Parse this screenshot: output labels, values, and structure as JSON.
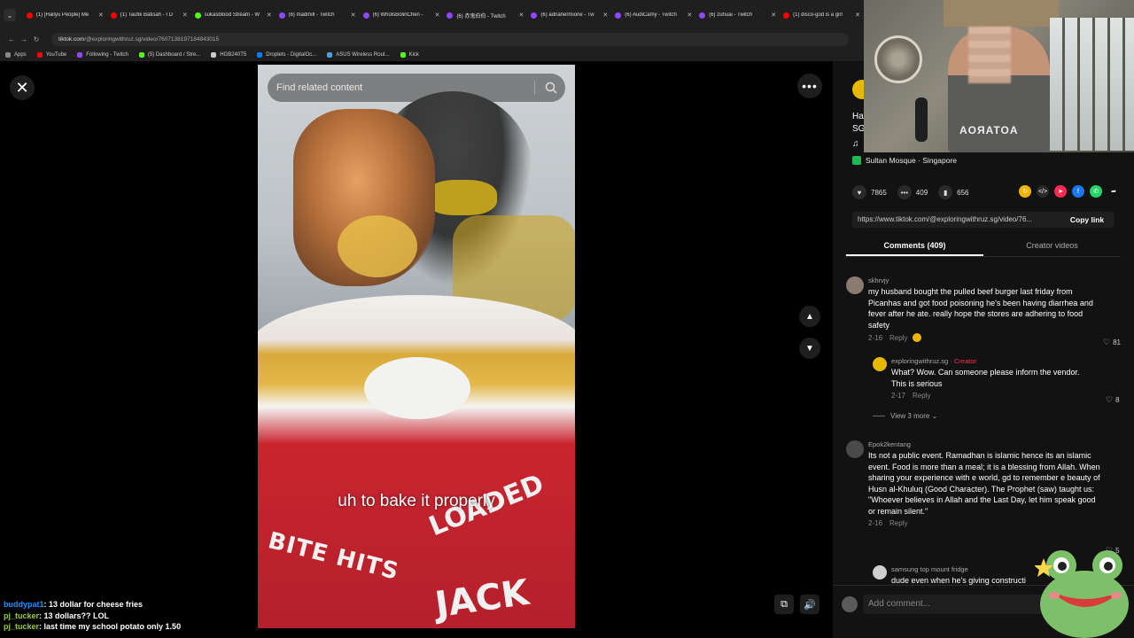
{
  "browser": {
    "tabs": [
      {
        "title": "(1) [Hallyu People] Me",
        "color": "#ff0000"
      },
      {
        "title": "(1) Taufik Batisah - I D",
        "color": "#ff0000"
      },
      {
        "title": "sukasblood Stream - W",
        "color": "#53fc18"
      },
      {
        "title": "(6) madmill - Twitch",
        "color": "#9146ff"
      },
      {
        "title": "(6) WholsBolinChen -",
        "color": "#9146ff"
      },
      {
        "title": "(6) 赤鬼伯伯 - Twitch",
        "color": "#9146ff"
      },
      {
        "title": "(6) adriahermione - Tw",
        "color": "#9146ff"
      },
      {
        "title": "(6) AudiCamy - Twitch",
        "color": "#9146ff"
      },
      {
        "title": "(6) zuhuai - Twitch",
        "color": "#9146ff"
      },
      {
        "title": "(1) disco-god is a girl",
        "color": "#ff0000"
      }
    ],
    "url_domain": "tiktok.com",
    "url_path": "/@exploringwithruz.sg/video/7607138197184843015",
    "bookmarks": [
      {
        "label": "Apps",
        "color": "#888888"
      },
      {
        "label": "YouTube",
        "color": "#ff0000"
      },
      {
        "label": "Following - Twitch",
        "color": "#9146ff"
      },
      {
        "label": "(5) Dashboard / Stre...",
        "color": "#53fc18"
      },
      {
        "label": "HGB240T5",
        "color": "#cccccc"
      },
      {
        "label": "Droplets - DigitalOc...",
        "color": "#0080ff"
      },
      {
        "label": "ASUS Wireless Rout...",
        "color": "#4aa3df"
      },
      {
        "label": "Kick",
        "color": "#53fc18"
      }
    ]
  },
  "video": {
    "search_placeholder": "Find related content",
    "caption": "uh to bake it properly",
    "cup_text_1": "BITE HITS",
    "cup_text_2": "LOADED",
    "cup_text_3": "JACK"
  },
  "webcam": {
    "shirt_text": "AOЯATOA"
  },
  "post": {
    "title_line1": "Ha",
    "title_line2": "SG",
    "music_icon": "♫",
    "location": "Sultan Mosque · Singapore",
    "likes": "7865",
    "comments": "409",
    "saves": "656",
    "link": "https://www.tiktok.com/@exploringwithruz.sg/video/76...",
    "copy_link": "Copy link",
    "tab_comments": "Comments (409)",
    "tab_creator": "Creator videos"
  },
  "comments": [
    {
      "user": "skhrvjy",
      "text": "my husband bought the pulled beef burger last friday from Picanhas and got food poisoning he's been having diarrhea and fever after he ate. really hope the stores are adhering to food safety",
      "date": "2-16",
      "reply": "Reply",
      "likes": "81"
    },
    {
      "user": "exploringwithruz.sg",
      "creator": "· Creator",
      "text": "What? Wow. Can someone please inform the vendor. This is serious",
      "date": "2-17",
      "reply": "Reply",
      "likes": "8"
    },
    {
      "user": "Epok2kentang",
      "text": "Its not a public event. Ramadhan is islamic hence its an islamic event. Food is more than a meal; it is a blessing from Allah. When sharing your experience with e world, gd to remember e beauty of Husn al-Khuluq (Good Character). The Prophet (saw) taught us: \"Whoever believes in Allah and the Last Day, let him speak good or remain silent.\"",
      "date": "2-16",
      "reply": "Reply",
      "likes": "5"
    },
    {
      "user": "samsung top mount fridge",
      "text": "dude even when he's giving constructi"
    }
  ],
  "view_more": "View 3 more",
  "add_comment_placeholder": "Add comment...",
  "chat": [
    {
      "user": "buddypat1",
      "msg": " 13 dollar for cheese fries",
      "color": "#1e90ff"
    },
    {
      "user": "pj_tucker",
      "msg": " 13 dollars?? LOL",
      "color": "#9acd32"
    },
    {
      "user": "pj_tucker",
      "msg": " last time my school potato only 1.50",
      "color": "#9acd32"
    }
  ]
}
